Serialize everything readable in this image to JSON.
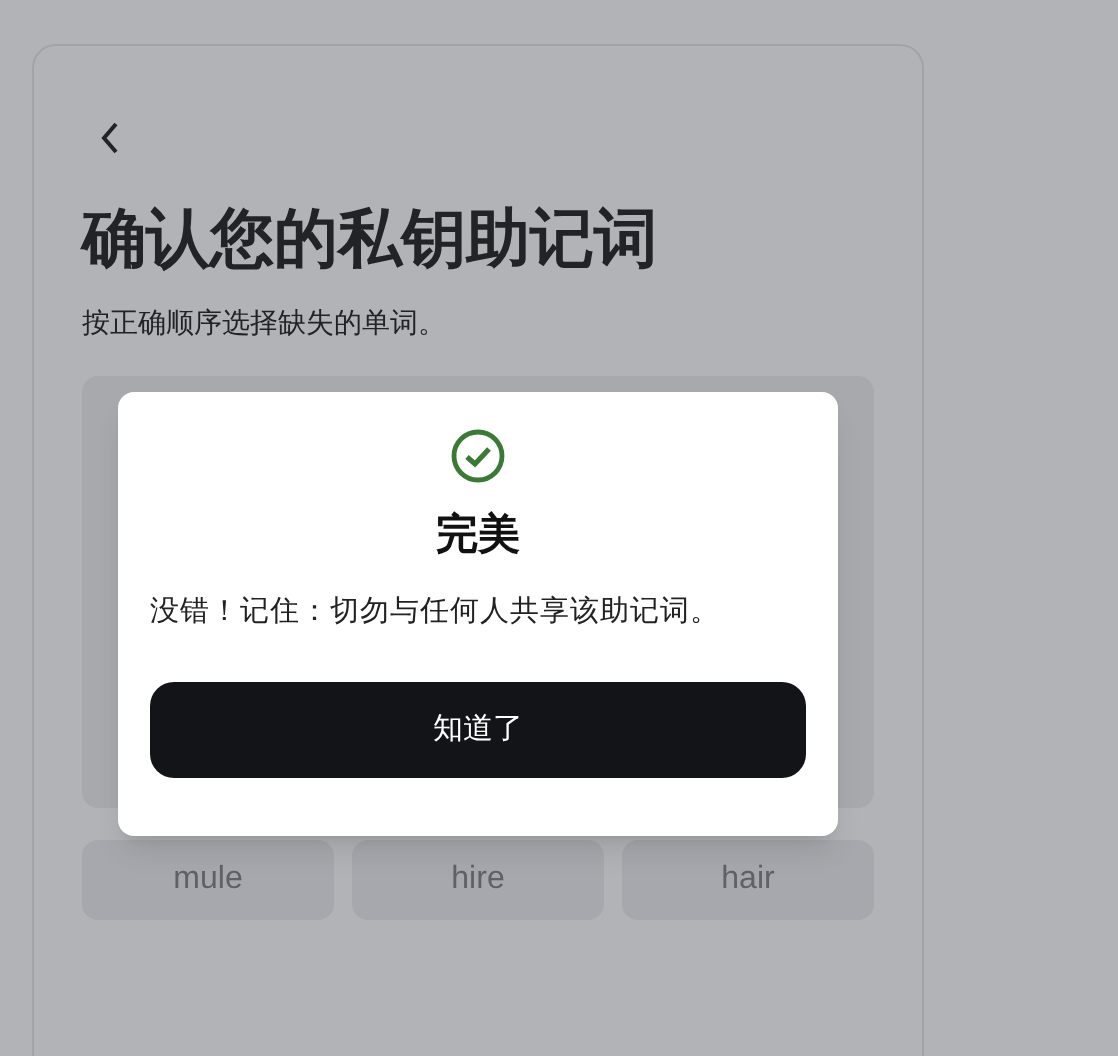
{
  "page": {
    "title": "确认您的私钥助记词",
    "subtitle": "按正确顺序选择缺失的单词。"
  },
  "word_options": [
    {
      "label": "mule"
    },
    {
      "label": "hire"
    },
    {
      "label": "hair"
    }
  ],
  "dialog": {
    "title": "完美",
    "message": "没错！记住：切勿与任何人共享该助记词。",
    "button": "知道了"
  }
}
